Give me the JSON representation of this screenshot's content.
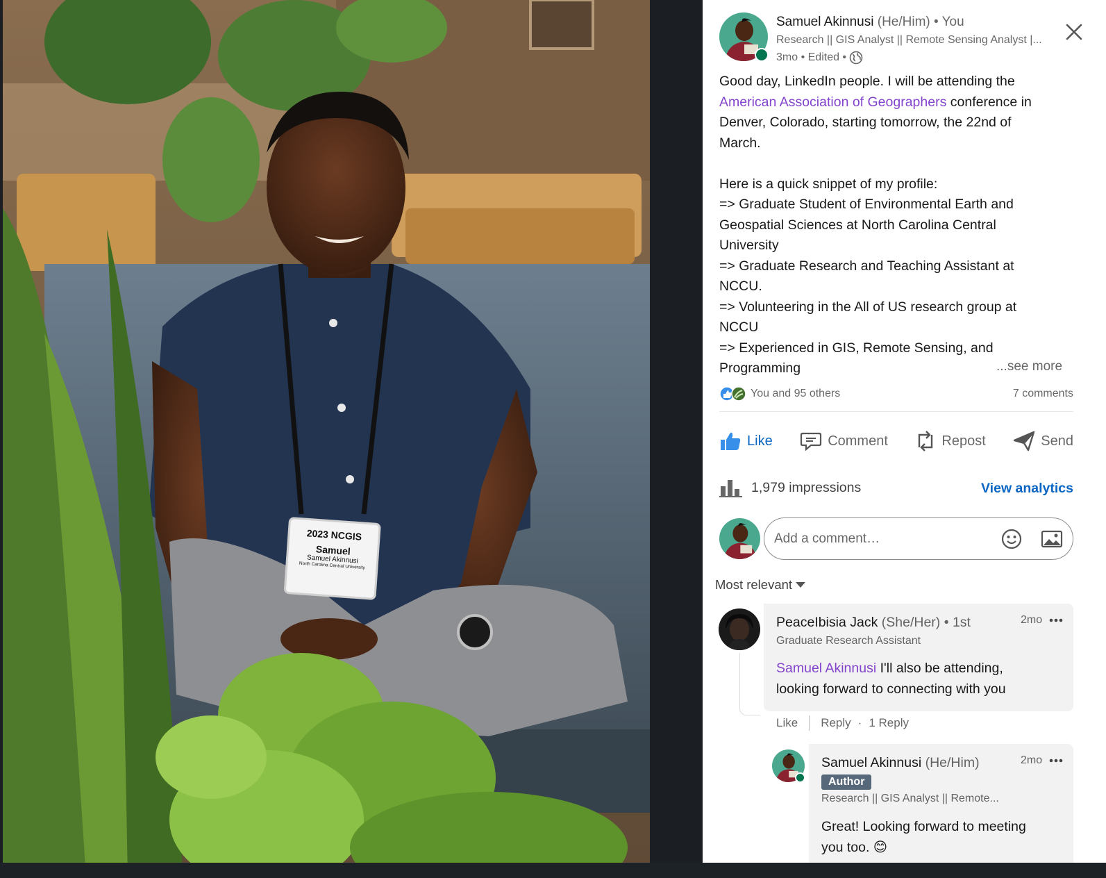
{
  "post": {
    "author": {
      "name": "Samuel Akinnusi",
      "pronouns": "(He/Him)",
      "degree": "• You",
      "headline": "Research || GIS Analyst || Remote Sensing Analyst |...",
      "time": "3mo • Edited •",
      "visibility_icon": "globe-icon"
    },
    "body": {
      "line1": "Good day, LinkedIn people. I will be attending the",
      "mention": "American Association of Geographers",
      "line2_rest": " conference in",
      "line3": "Denver, Colorado, starting tomorrow, the 22nd of",
      "line4": "March.",
      "line6": "Here is a quick snippet of my profile:",
      "line7": "=> Graduate Student of Environmental Earth and",
      "line8": "Geospatial Sciences at North Carolina Central",
      "line9": "University",
      "line10": "=> Graduate Research and Teaching Assistant at",
      "line11": "NCCU.",
      "line12": "=> Volunteering in the All of US research group at",
      "line13": "NCCU",
      "line14": "=> Experienced in GIS, Remote Sensing, and",
      "line15": "Programming"
    },
    "see_more": "...see more",
    "reactions_text": "You and 95 others",
    "comments_count": "7 comments",
    "actions": {
      "like": "Like",
      "comment": "Comment",
      "repost": "Repost",
      "send": "Send"
    },
    "impressions": "1,979 impressions",
    "view_analytics": "View analytics",
    "comment_placeholder": "Add a comment…",
    "sort_label": "Most relevant"
  },
  "photo": {
    "badge_title": "2023 NCGIS",
    "badge_name": "Samuel",
    "badge_fullname": "Samuel Akinnusi",
    "badge_school": "North Carolina Central University"
  },
  "comments": [
    {
      "name": "PeaceIbisia Jack",
      "pronouns": "(She/Her)",
      "degree": "• 1st",
      "headline": "Graduate Research Assistant",
      "time": "2mo",
      "mention": "Samuel Akinnusi",
      "text_line1": " I'll also be attending,",
      "text_line2": "looking forward to connecting with you",
      "like": "Like",
      "reply": "Reply",
      "replies": "1 Reply"
    },
    {
      "name": "Samuel Akinnusi",
      "pronouns": "(He/Him)",
      "badge": "Author",
      "headline": "Research || GIS Analyst || Remote...",
      "time": "2mo",
      "text_line1": "Great! Looking forward to meeting",
      "text_line2": "you too. 😊"
    }
  ],
  "colors": {
    "accent_blue": "#0a66c2",
    "mention_purple": "#8344cc",
    "online_green": "#01754f",
    "author_badge": "#56687a"
  }
}
